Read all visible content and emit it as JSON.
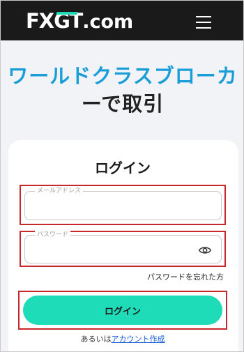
{
  "header": {
    "logo_fx": "FX",
    "logo_gt": "GT",
    "logo_com": ".com",
    "menu_icon": "hamburger-menu-icon"
  },
  "hero": {
    "line1": "ワールドクラスブローカ",
    "line2": "ーで取引"
  },
  "login": {
    "title": "ログイン",
    "email_label": "メールアドレス",
    "email_value": "",
    "password_label": "パスワード",
    "password_value": "",
    "eye_icon": "eye-icon",
    "forgot_label": "パスワードを忘れた方",
    "submit_label": "ログイン",
    "or_text": "あるいは",
    "create_account_label": "アカウント作成"
  },
  "colors": {
    "header_bg": "#1a1a1a",
    "accent": "#1fdcb8",
    "heading_blue": "#1a9ed8",
    "highlight_red": "#c8282d",
    "link": "#1a5fd6"
  }
}
